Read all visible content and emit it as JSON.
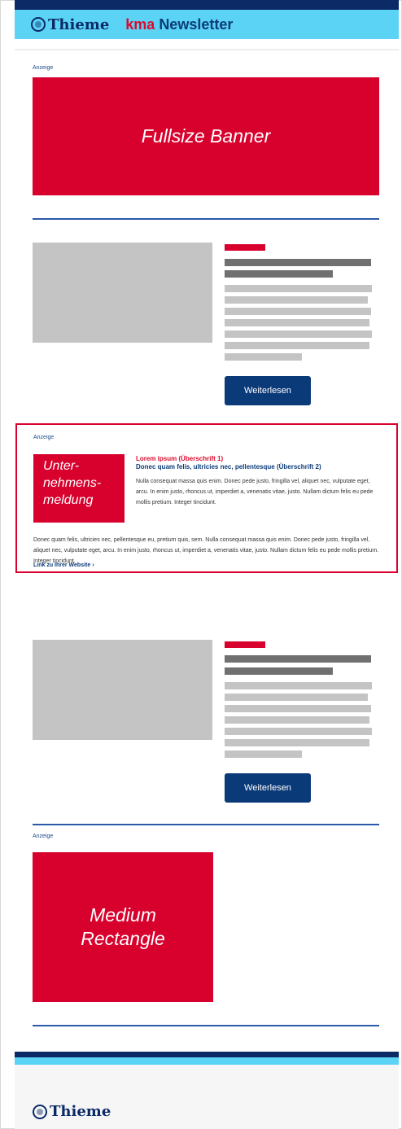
{
  "header": {
    "brand": "Thieme",
    "kma": "kma",
    "newsletter": "Newsletter"
  },
  "ad_label": "Anzeige",
  "fullsize_banner": {
    "text": "Fullsize Banner"
  },
  "articles": [
    {
      "button_label": "Weiterlesen"
    },
    {
      "button_label": "Weiterlesen"
    }
  ],
  "company_news": {
    "block_text": "Unter-\nnehmens-\nmeldung",
    "heading1": "Lorem ipsum (Überschrift 1)",
    "heading2": "Donec quam felis, ultricies nec, pellentesque (Überschrift 2)",
    "paragraph1": "Nulla consequat massa quis enim. Donec pede justo, fringilla vel, aliquet nec, vulputate eget, arcu. In enim justo, rhoncus ut, imperdiet a, venenatis vitae, justo. Nullam dictum felis eu pede mollis pretium. Integer tincidunt.",
    "paragraph2": "Donec quam felis, ultricies nec, pellentesque eu, pretium quis, sem. Nulla consequat massa quis enim. Donec pede justo, fringilla vel, aliquet nec, vulputate eget, arcu. In enim justo, rhoncus ut, imperdiet a, venenatis vitae, justo. Nullam dictum felis eu pede mollis pretium. Integer tincidunt.",
    "link": "Link zu Ihrer Website ›"
  },
  "medium_rectangle": {
    "text": "Medium\nRectangle"
  },
  "footer": {
    "brand": "Thieme"
  },
  "colors": {
    "navy": "#0b2a66",
    "sky": "#5bd3f5",
    "red": "#d8002d",
    "button": "#0b3a78"
  }
}
